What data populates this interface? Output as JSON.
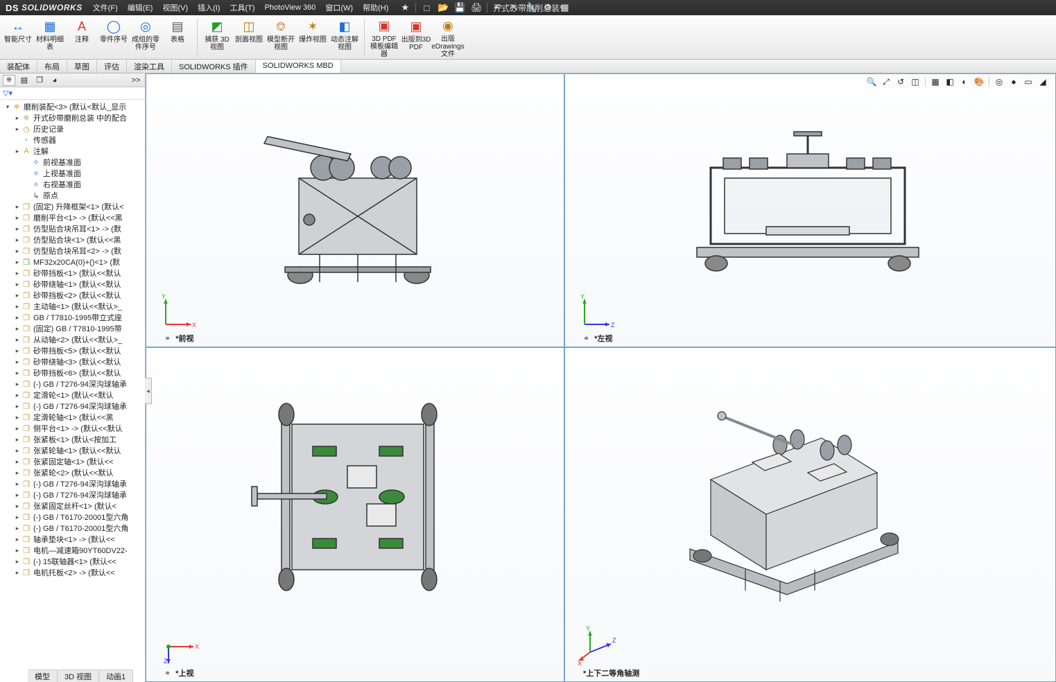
{
  "app": {
    "brand_ds": "DS",
    "brand": "SOLIDWORKS",
    "doc_title": "开式砂带磨削总装*"
  },
  "menus": [
    {
      "label": "文件(F)"
    },
    {
      "label": "编辑(E)"
    },
    {
      "label": "视图(V)"
    },
    {
      "label": "插入(I)"
    },
    {
      "label": "工具(T)"
    },
    {
      "label": "PhotoView 360"
    },
    {
      "label": "窗口(W)"
    },
    {
      "label": "帮助(H)"
    }
  ],
  "qat": [
    {
      "name": "search-icon",
      "glyph": "★"
    },
    {
      "name": "new-icon",
      "glyph": "□"
    },
    {
      "name": "open-icon",
      "glyph": "📂"
    },
    {
      "name": "save-icon",
      "glyph": "💾"
    },
    {
      "name": "print-icon",
      "glyph": "🖨"
    },
    {
      "name": "undo-icon",
      "glyph": "↶"
    },
    {
      "name": "select-icon",
      "glyph": "↖"
    },
    {
      "name": "rebuild-icon",
      "glyph": "🔧"
    },
    {
      "name": "options-icon",
      "glyph": "⚙"
    },
    {
      "name": "view-icon",
      "glyph": "▦"
    }
  ],
  "ribbon": [
    {
      "name": "smart-dimension",
      "label": "智能尺寸",
      "color": "#1e6fd6",
      "glyph": "↔"
    },
    {
      "name": "bom",
      "label": "材料明细表",
      "color": "#1e6fd6",
      "glyph": "▦"
    },
    {
      "name": "note",
      "label": "注释",
      "color": "#d03a2a",
      "glyph": "A"
    },
    {
      "name": "balloon",
      "label": "零件序号",
      "color": "#1e6fd6",
      "glyph": "◯"
    },
    {
      "name": "auto-balloon",
      "label": "成组的零件序号",
      "color": "#1e6fd6",
      "glyph": "◎"
    },
    {
      "name": "tables",
      "label": "表格",
      "color": "#5a5a5a",
      "glyph": "▤"
    },
    {
      "name": "capture-3d-view",
      "label": "捕获 3D视图",
      "color": "#1aa129",
      "glyph": "◩"
    },
    {
      "name": "section-view",
      "label": "剖面视图",
      "color": "#c17a1a",
      "glyph": "◫"
    },
    {
      "name": "model-break-view",
      "label": "模型断开视图",
      "color": "#c17a1a",
      "glyph": "⎊"
    },
    {
      "name": "exploded-view",
      "label": "爆炸视图",
      "color": "#c17a1a",
      "glyph": "✶"
    },
    {
      "name": "dynamic-annotation",
      "label": "动态注解视图",
      "color": "#1e6fd6",
      "glyph": "◧"
    },
    {
      "name": "3d-pdf-template",
      "label": "3D PDF模板编辑器",
      "color": "#d03a2a",
      "glyph": "▣"
    },
    {
      "name": "publish-3dpdf",
      "label": "出版到3D PDF",
      "color": "#d03a2a",
      "glyph": "▣"
    },
    {
      "name": "publish-edrawings",
      "label": "出版eDrawings文件",
      "color": "#c17a1a",
      "glyph": "◉"
    }
  ],
  "tabs": [
    {
      "label": "装配体"
    },
    {
      "label": "布局"
    },
    {
      "label": "草图"
    },
    {
      "label": "评估"
    },
    {
      "label": "渲染工具"
    },
    {
      "label": "SOLIDWORKS 插件"
    },
    {
      "label": "SOLIDWORKS MBD",
      "active": true
    }
  ],
  "tree_tabs": [
    {
      "name": "feature-tree-tab",
      "glyph": "⎈",
      "active": true
    },
    {
      "name": "property-tab",
      "glyph": "▤"
    },
    {
      "name": "config-tab",
      "glyph": "❐"
    },
    {
      "name": "appearance-tab",
      "glyph": "◕"
    }
  ],
  "tree_expand": ">>",
  "filter_glyph": "▽▾",
  "tree": [
    {
      "d": 0,
      "tw": "▾",
      "ic": "⎈",
      "c": "#c99b2f",
      "t": "磨削装配<3> (默认<默认_显示"
    },
    {
      "d": 1,
      "tw": "▸",
      "ic": "⎈",
      "c": "#c99b2f",
      "t": "开式砂带磨削总装 中的配合"
    },
    {
      "d": 1,
      "tw": "▸",
      "ic": "◷",
      "c": "#c99b2f",
      "t": "历史记录"
    },
    {
      "d": 1,
      "tw": "",
      "ic": "◦",
      "c": "#2a6bd6",
      "t": "传感器"
    },
    {
      "d": 1,
      "tw": "▸",
      "ic": "A",
      "c": "#d4a72e",
      "t": "注解"
    },
    {
      "d": 2,
      "tw": "",
      "ic": "✧",
      "c": "#2a6bd6",
      "t": "前视基准面"
    },
    {
      "d": 2,
      "tw": "",
      "ic": "✧",
      "c": "#2a6bd6",
      "t": "上视基准面"
    },
    {
      "d": 2,
      "tw": "",
      "ic": "✧",
      "c": "#2a6bd6",
      "t": "右视基准面"
    },
    {
      "d": 2,
      "tw": "",
      "ic": "↳",
      "c": "#555",
      "t": "原点"
    },
    {
      "d": 1,
      "tw": "▸",
      "ic": "❒",
      "c": "#c99b2f",
      "t": "(固定) 升降框架<1> (默认<"
    },
    {
      "d": 1,
      "tw": "▸",
      "ic": "❒",
      "c": "#c99b2f",
      "t": "磨削平台<1> -> (默认<<黑"
    },
    {
      "d": 1,
      "tw": "▸",
      "ic": "❒",
      "c": "#c99b2f",
      "t": "仿型贴合块吊耳<1> -> (默"
    },
    {
      "d": 1,
      "tw": "▸",
      "ic": "❒",
      "c": "#c99b2f",
      "t": "仿型贴合块<1> (默认<<黑"
    },
    {
      "d": 1,
      "tw": "▸",
      "ic": "❒",
      "c": "#c99b2f",
      "t": "仿型贴合块吊耳<2> -> (默"
    },
    {
      "d": 1,
      "tw": "▸",
      "ic": "❒",
      "c": "#4aa84a",
      "t": "MF32x20CA(0)+()<1> (默"
    },
    {
      "d": 1,
      "tw": "▸",
      "ic": "❒",
      "c": "#c99b2f",
      "t": "砂带挡板<1> (默认<<默认"
    },
    {
      "d": 1,
      "tw": "▸",
      "ic": "❒",
      "c": "#c99b2f",
      "t": "砂带绕轴<1> (默认<<默认"
    },
    {
      "d": 1,
      "tw": "▸",
      "ic": "❒",
      "c": "#c99b2f",
      "t": "砂带挡板<2> (默认<<默认"
    },
    {
      "d": 1,
      "tw": "▸",
      "ic": "❒",
      "c": "#c99b2f",
      "t": "主动轴<1> (默认<<默认>_"
    },
    {
      "d": 1,
      "tw": "▸",
      "ic": "❒",
      "c": "#c99b2f",
      "t": "GB / T7810-1995带立式座"
    },
    {
      "d": 1,
      "tw": "▸",
      "ic": "❒",
      "c": "#c99b2f",
      "t": "(固定) GB / T7810-1995带"
    },
    {
      "d": 1,
      "tw": "▸",
      "ic": "❒",
      "c": "#c99b2f",
      "t": "从动轴<2> (默认<<默认>_"
    },
    {
      "d": 1,
      "tw": "▸",
      "ic": "❒",
      "c": "#c99b2f",
      "t": "砂带挡板<5> (默认<<默认"
    },
    {
      "d": 1,
      "tw": "▸",
      "ic": "❒",
      "c": "#c99b2f",
      "t": "砂带绕轴<3> (默认<<默认"
    },
    {
      "d": 1,
      "tw": "▸",
      "ic": "❒",
      "c": "#c99b2f",
      "t": "砂带挡板<6> (默认<<默认"
    },
    {
      "d": 1,
      "tw": "▸",
      "ic": "❒",
      "c": "#c99b2f",
      "t": "(-) GB / T276-94深沟球轴承"
    },
    {
      "d": 1,
      "tw": "▸",
      "ic": "❒",
      "c": "#c99b2f",
      "t": "定滑轮<1> (默认<<默认"
    },
    {
      "d": 1,
      "tw": "▸",
      "ic": "❒",
      "c": "#c99b2f",
      "t": "(-) GB / T276-94深沟球轴承"
    },
    {
      "d": 1,
      "tw": "▸",
      "ic": "❒",
      "c": "#c99b2f",
      "t": "定滑轮轴<1> (默认<<黑"
    },
    {
      "d": 1,
      "tw": "▸",
      "ic": "❒",
      "c": "#c99b2f",
      "t": "侧平台<1> -> (默认<<默认"
    },
    {
      "d": 1,
      "tw": "▸",
      "ic": "❒",
      "c": "#c99b2f",
      "t": "张紧板<1> (默认<按加工"
    },
    {
      "d": 1,
      "tw": "▸",
      "ic": "❒",
      "c": "#c99b2f",
      "t": "张紧轮轴<1> (默认<<默认"
    },
    {
      "d": 1,
      "tw": "▸",
      "ic": "❒",
      "c": "#c99b2f",
      "t": "张紧固定轴<1> (默认<<"
    },
    {
      "d": 1,
      "tw": "▸",
      "ic": "❒",
      "c": "#c99b2f",
      "t": "张紧轮<2> (默认<<默认"
    },
    {
      "d": 1,
      "tw": "▸",
      "ic": "❒",
      "c": "#c99b2f",
      "t": "(-) GB / T276-94深沟球轴承"
    },
    {
      "d": 1,
      "tw": "▸",
      "ic": "❒",
      "c": "#c99b2f",
      "t": "(-) GB / T276-94深沟球轴承"
    },
    {
      "d": 1,
      "tw": "▸",
      "ic": "❒",
      "c": "#c99b2f",
      "t": "张紧固定丝杆<1> (默认<"
    },
    {
      "d": 1,
      "tw": "▸",
      "ic": "❒",
      "c": "#c99b2f",
      "t": "(-) GB / T6170-20001型六角"
    },
    {
      "d": 1,
      "tw": "▸",
      "ic": "❒",
      "c": "#c99b2f",
      "t": "(-) GB / T6170-20001型六角"
    },
    {
      "d": 1,
      "tw": "▸",
      "ic": "❒",
      "c": "#c99b2f",
      "t": "轴承垫块<1> -> (默认<<"
    },
    {
      "d": 1,
      "tw": "▸",
      "ic": "❒",
      "c": "#c99b2f",
      "t": "电机—减速箱90YT60DV22-"
    },
    {
      "d": 1,
      "tw": "▸",
      "ic": "❒",
      "c": "#c99b2f",
      "t": "(-) 15联轴器<1> (默认<<"
    },
    {
      "d": 1,
      "tw": "▸",
      "ic": "❒",
      "c": "#c99b2f",
      "t": "电机托板<2> -> (默认<<"
    }
  ],
  "hud": [
    {
      "name": "zoom-fit-icon",
      "glyph": "🔍"
    },
    {
      "name": "zoom-area-icon",
      "glyph": "⤢"
    },
    {
      "name": "prev-view-icon",
      "glyph": "↺"
    },
    {
      "name": "section-icon",
      "glyph": "◫"
    },
    {
      "name": "view-orient-icon",
      "glyph": "▦"
    },
    {
      "name": "display-style-icon",
      "glyph": "◧"
    },
    {
      "name": "hide-show-icon",
      "glyph": "◐"
    },
    {
      "name": "appearance-icon",
      "glyph": "🎨"
    },
    {
      "name": "scene-icon",
      "glyph": "◎"
    },
    {
      "name": "render-icon",
      "glyph": "●"
    },
    {
      "name": "wireframe-icon",
      "glyph": "▭"
    },
    {
      "name": "shadow-icon",
      "glyph": "◢"
    }
  ],
  "views": {
    "front": "*前视",
    "left": "*左视",
    "top": "*上视",
    "iso": "*上下二等角轴测"
  },
  "bottom_tabs": [
    {
      "label": "模型"
    },
    {
      "label": "3D 视图"
    },
    {
      "label": "动画1"
    }
  ],
  "link_glyph": "⚭"
}
